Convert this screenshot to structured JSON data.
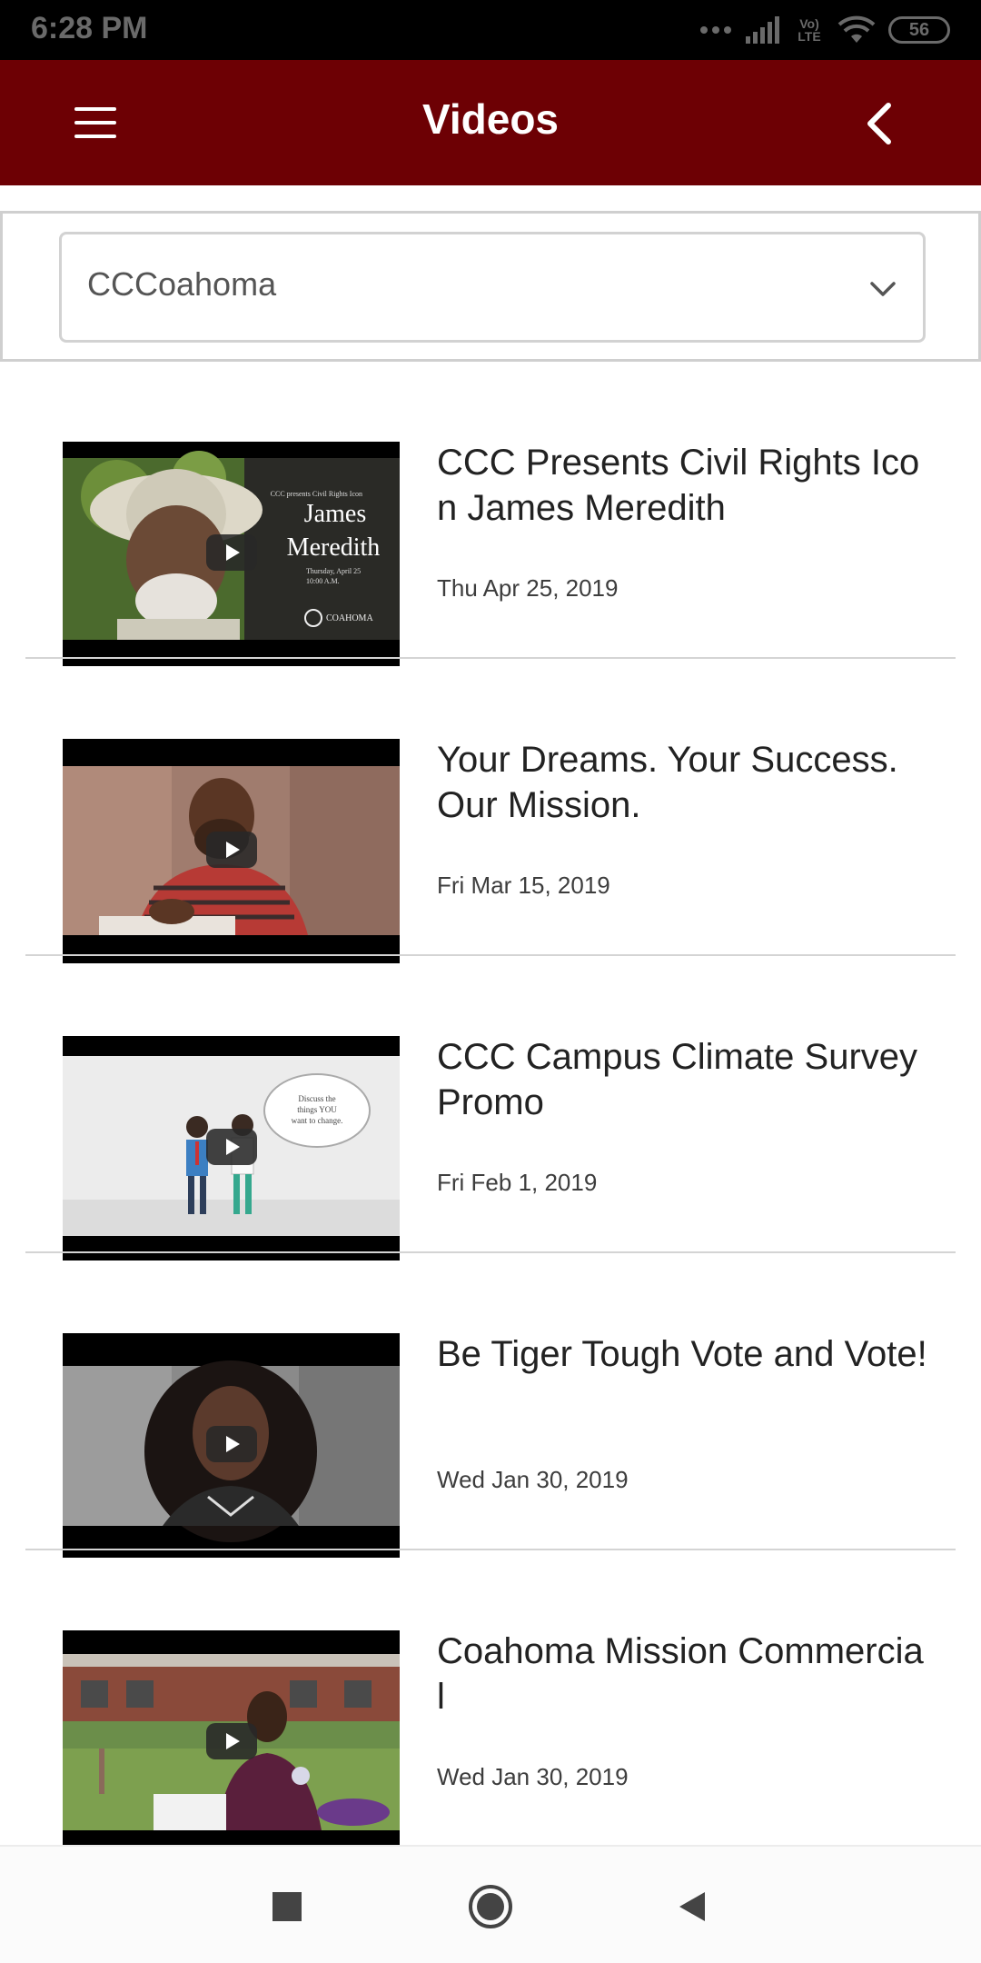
{
  "status_bar": {
    "time": "6:28 PM",
    "network_label": "Vo) LTE",
    "battery": "56"
  },
  "app_bar": {
    "title": "Videos"
  },
  "filter": {
    "selected": "CCCoahoma"
  },
  "videos": [
    {
      "title": "CCC Presents Civil Rights Icon James Meredith",
      "date": "Thu Apr 25, 2019",
      "thumbnail_icon": "james-meredith-thumbnail",
      "thumbnail_text": [
        "CCC presents Civil Rights Icon",
        "James",
        "Meredith",
        "Thursday, April 25",
        "10:00 A.M.",
        "COAHOMA"
      ]
    },
    {
      "title": "Your Dreams. Your Success. Our Mission.",
      "date": "Fri Mar 15, 2019",
      "thumbnail_icon": "student-writing-thumbnail"
    },
    {
      "title": "CCC Campus Climate Survey Promo",
      "date": "Fri Feb 1, 2019",
      "thumbnail_icon": "animated-figures-thumbnail",
      "thumbnail_text": [
        "Discuss the",
        "things YOU",
        "want to change."
      ]
    },
    {
      "title": "Be Tiger Tough Vote and Vote!",
      "date": "Wed Jan 30, 2019",
      "thumbnail_icon": "student-portrait-thumbnail"
    },
    {
      "title": "Coahoma Mission Commercial",
      "date": "Wed Jan 30, 2019",
      "thumbnail_icon": "campus-student-thumbnail"
    }
  ],
  "colors": {
    "app_bar": "#6d0004",
    "status_bar": "#000000",
    "divider": "#d4d4d4"
  },
  "nav": {
    "icons": [
      "recents-square-icon",
      "home-circle-icon",
      "back-triangle-icon"
    ]
  }
}
